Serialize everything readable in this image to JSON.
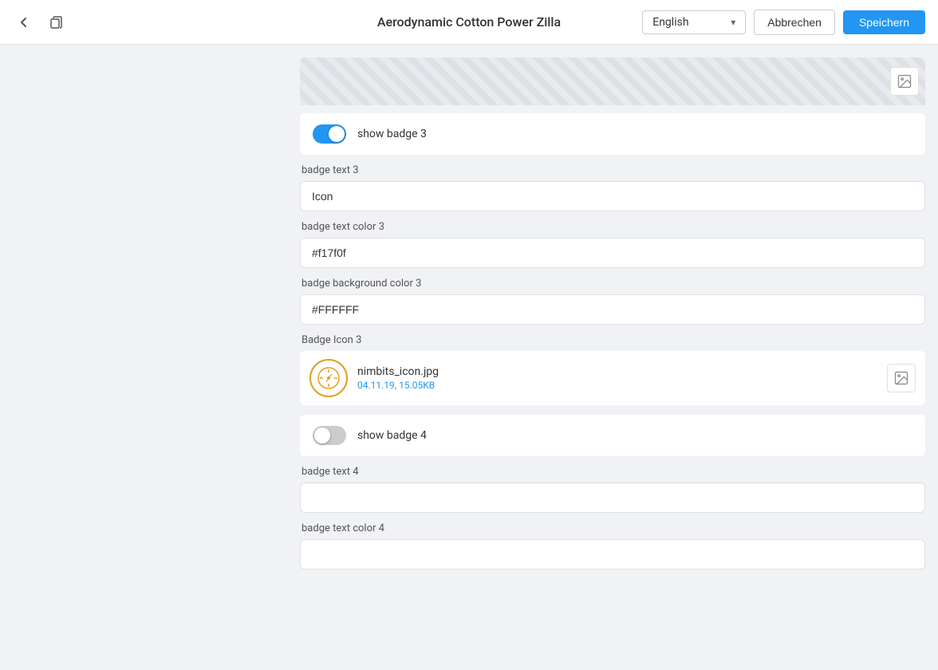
{
  "navbar": {
    "title": "Aerodynamic Cotton Power Zilla",
    "language": "English",
    "cancel_label": "Abbrechen",
    "save_label": "Speichern"
  },
  "form": {
    "badge3": {
      "show_toggle_label": "show badge 3",
      "show_toggle_state": "on",
      "badge_text_label": "badge text 3",
      "badge_text_value": "Icon",
      "badge_text_color_label": "badge text color 3",
      "badge_text_color_value": "#f17f0f",
      "badge_bg_color_label": "badge background color 3",
      "badge_bg_color_value": "#FFFFFF",
      "badge_icon_label": "Badge Icon 3",
      "badge_icon_filename": "nimbits_icon.jpg",
      "badge_icon_filesize": "04.11.19, 15.05KB"
    },
    "badge4": {
      "show_toggle_label": "show badge 4",
      "show_toggle_state": "off",
      "badge_text_label": "badge text 4",
      "badge_text_value": "",
      "badge_text_color_label": "badge text color 4",
      "badge_text_color_value": ""
    }
  },
  "icons": {
    "back": "‹",
    "duplicate": "⧉",
    "image": "🖼",
    "chevron_down": "▾"
  }
}
